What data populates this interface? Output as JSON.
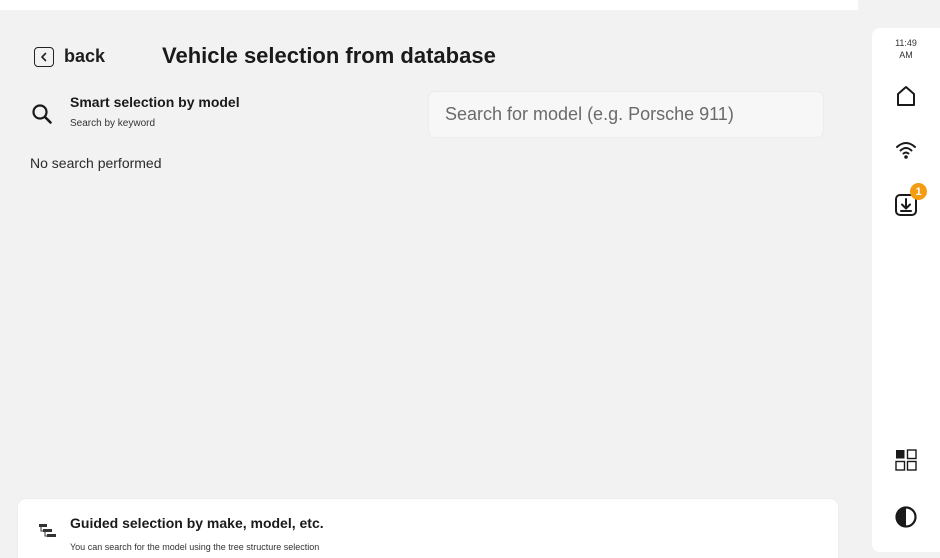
{
  "header": {
    "back_label": "back",
    "title": "Vehicle selection from database"
  },
  "smart_selection": {
    "icon": "search-icon",
    "title": "Smart selection by model",
    "subtitle": "Search by keyword",
    "search_placeholder": "Search for model (e.g. Porsche 911)",
    "search_value": "",
    "empty_state": "No search performed"
  },
  "guided_selection": {
    "icon": "tree-structure-icon",
    "title": "Guided selection by make, model, etc.",
    "subtitle": "You can search for the model using the tree structure selection"
  },
  "sidebar": {
    "time": "11:49",
    "meridiem": "AM",
    "icons": [
      "home-icon",
      "wifi-icon",
      "download-icon",
      "apps-icon",
      "contrast-icon"
    ],
    "download_badge": "1",
    "badge_color": "#f39c12"
  }
}
